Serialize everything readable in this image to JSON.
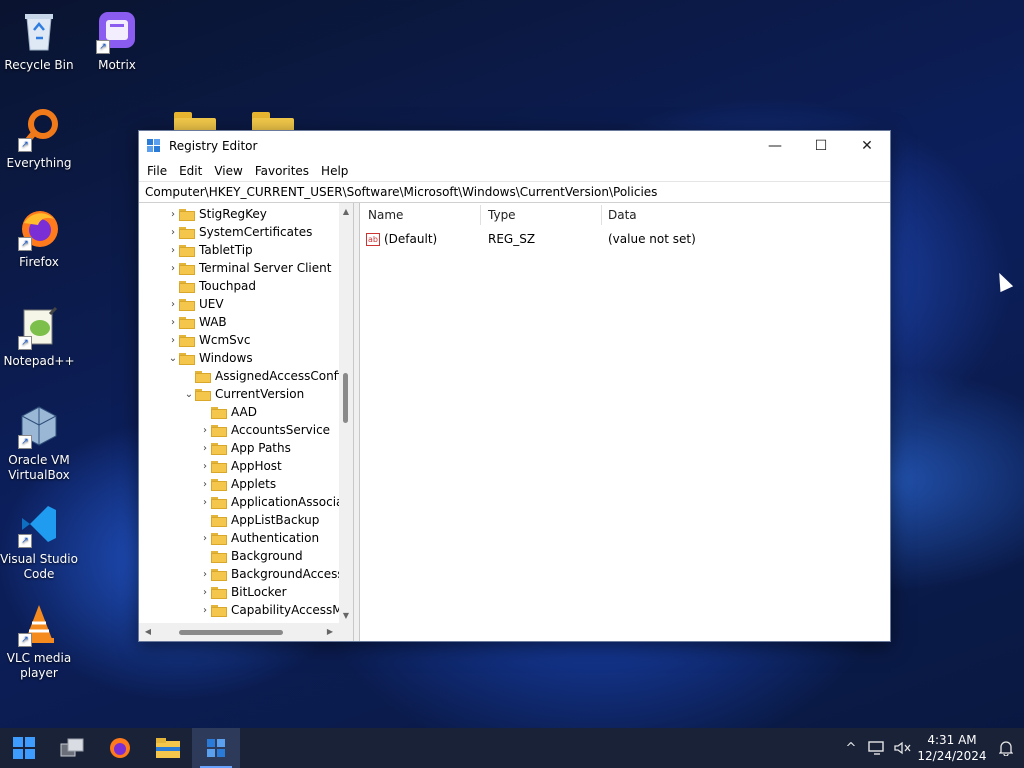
{
  "desktop": {
    "icons": [
      {
        "label": "Recycle Bin"
      },
      {
        "label": "Motrix"
      },
      {
        "label": "Everything"
      },
      {
        "label": "Firefox"
      },
      {
        "label": "Notepad++"
      },
      {
        "label": "Oracle VM VirtualBox"
      },
      {
        "label": "Visual Studio Code"
      },
      {
        "label": "VLC media player"
      }
    ]
  },
  "window": {
    "title": "Registry Editor",
    "controls": {
      "minimize": "—",
      "maximize": "☐",
      "close": "✕"
    },
    "menu": [
      "File",
      "Edit",
      "View",
      "Favorites",
      "Help"
    ],
    "address": "Computer\\HKEY_CURRENT_USER\\Software\\Microsoft\\Windows\\CurrentVersion\\Policies",
    "tree": [
      {
        "label": "StigRegKey",
        "expander": "›"
      },
      {
        "label": "SystemCertificates",
        "expander": "›"
      },
      {
        "label": "TabletTip",
        "expander": "›"
      },
      {
        "label": "Terminal Server Client",
        "expander": "›"
      },
      {
        "label": "Touchpad",
        "expander": ""
      },
      {
        "label": "UEV",
        "expander": "›"
      },
      {
        "label": "WAB",
        "expander": "›"
      },
      {
        "label": "WcmSvc",
        "expander": "›"
      },
      {
        "label": "Windows",
        "expander": "⌄"
      },
      {
        "label": "AssignedAccessConfig",
        "expander": ""
      },
      {
        "label": "CurrentVersion",
        "expander": "⌄"
      },
      {
        "label": "AAD",
        "expander": ""
      },
      {
        "label": "AccountsService",
        "expander": "›"
      },
      {
        "label": "App Paths",
        "expander": "›"
      },
      {
        "label": "AppHost",
        "expander": "›"
      },
      {
        "label": "Applets",
        "expander": "›"
      },
      {
        "label": "ApplicationAssocia",
        "expander": "›"
      },
      {
        "label": "AppListBackup",
        "expander": ""
      },
      {
        "label": "Authentication",
        "expander": "›"
      },
      {
        "label": "Background",
        "expander": ""
      },
      {
        "label": "BackgroundAccess",
        "expander": "›"
      },
      {
        "label": "BitLocker",
        "expander": "›"
      },
      {
        "label": "CapabilityAccessMa",
        "expander": "›"
      }
    ],
    "columns": {
      "name": "Name",
      "type": "Type",
      "data": "Data"
    },
    "values": [
      {
        "icon": "ab",
        "name": "(Default)",
        "type": "REG_SZ",
        "data": "(value not set)"
      }
    ]
  },
  "taskbar": {
    "clock_time": "4:31 AM",
    "clock_date": "12/24/2024",
    "tray_chevron": "^"
  }
}
